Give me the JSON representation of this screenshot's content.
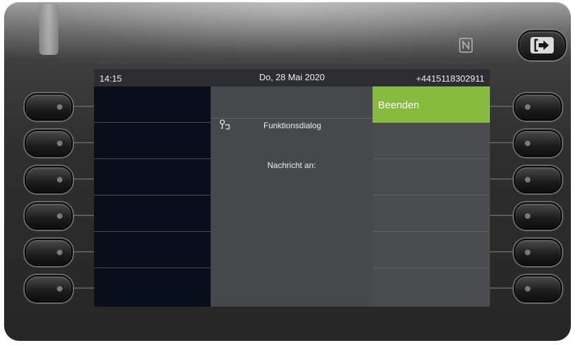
{
  "status_bar": {
    "time": "14:15",
    "date": "Do, 28 Mai 2020",
    "phone_number": "+4415118302911"
  },
  "center_panel": {
    "dialog_title": "Funktionsdialog",
    "message_label": "Nachricht an:"
  },
  "right_softkeys": [
    {
      "label": "Beenden",
      "active": true
    },
    {
      "label": ""
    },
    {
      "label": ""
    },
    {
      "label": ""
    },
    {
      "label": ""
    },
    {
      "label": ""
    }
  ],
  "colors": {
    "active_key": "#86bb3d",
    "left_panel": "#07101a",
    "center_panel": "#46484b",
    "right_panel": "#4a4c4f"
  },
  "icons": {
    "dialog": "function-dialog-icon",
    "nfc": "nfc-icon",
    "exit": "exit-icon"
  }
}
